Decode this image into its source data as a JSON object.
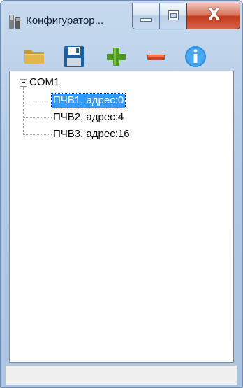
{
  "window": {
    "title": "Конфигуратор...",
    "close_glyph": "X"
  },
  "toolbar": {
    "open_icon": "folder-open-icon",
    "save_icon": "floppy-save-icon",
    "add_icon": "plus-icon",
    "remove_icon": "minus-icon",
    "info_icon": "info-icon"
  },
  "tree": {
    "root": {
      "label": "COM1",
      "expanded": true
    },
    "children": [
      {
        "label": "ПЧВ1, адрес:0",
        "selected": true
      },
      {
        "label": "ПЧВ2, адрес:4",
        "selected": false
      },
      {
        "label": "ПЧВ3, адрес:16",
        "selected": false
      }
    ]
  },
  "colors": {
    "selection": "#3399ff",
    "add": "#4e9a21",
    "remove": "#d9401a",
    "info": "#2a8ee0",
    "close": "#c2391c"
  }
}
